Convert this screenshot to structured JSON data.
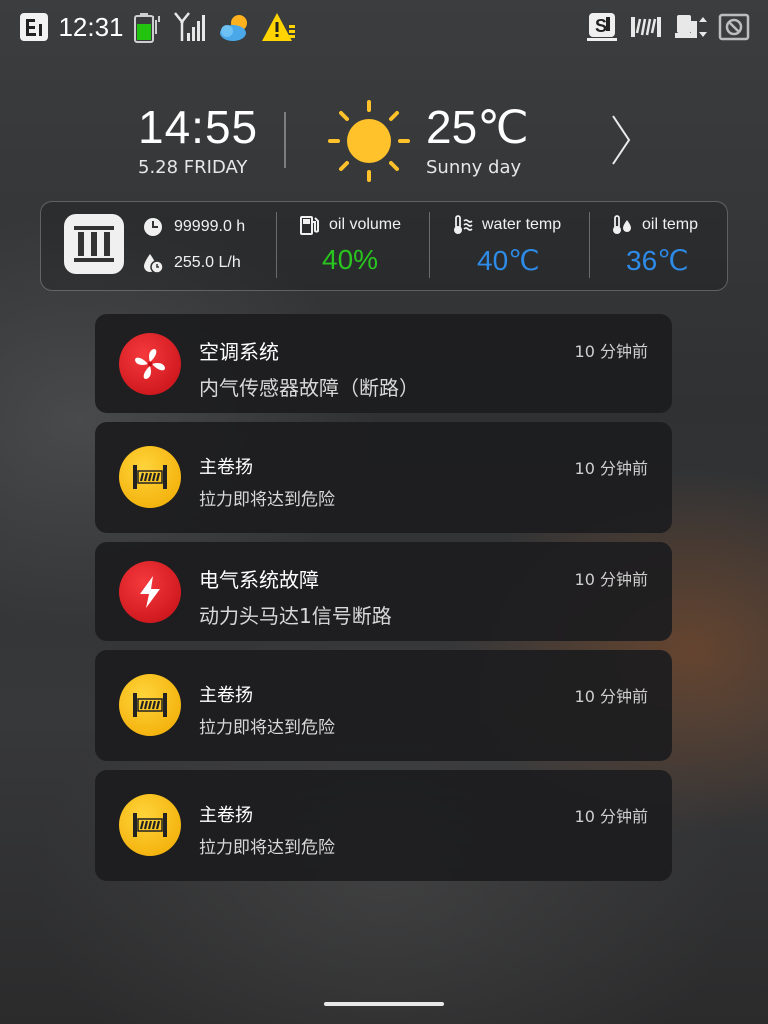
{
  "status_bar": {
    "time": "12:31",
    "left_icons": [
      "e1-badge-icon",
      "battery-charging-icon",
      "signal-icon",
      "weather-cloud-icon",
      "warning-icon"
    ],
    "right_icons": [
      "s-mode-icon",
      "winch-icon",
      "machine-icon",
      "camera-off-icon"
    ],
    "battery_color": "#22c40f",
    "warning_color": "#ffd400"
  },
  "clock": {
    "time": "14:55",
    "date": "5.28 FRIDAY"
  },
  "weather": {
    "temp": "25℃",
    "desc": "Sunny day",
    "icon": "sun-icon",
    "sun_color": "#ffc22a"
  },
  "info_panel": {
    "engine_icon": "engine-icon",
    "hours": "99999.0 h",
    "consumption": "255.0 L/h",
    "stats": [
      {
        "label": "oil volume",
        "value": "40%",
        "icon": "fuel-pump-icon",
        "color": "#29c41f"
      },
      {
        "label": "water temp",
        "value": "40℃",
        "icon": "water-temp-icon",
        "color": "#2e8be8"
      },
      {
        "label": "oil temp",
        "value": "36℃",
        "icon": "oil-temp-icon",
        "color": "#2e8be8"
      }
    ]
  },
  "notifications": [
    {
      "title": "空调系统",
      "message": "内气传感器故障（断路）",
      "time": "10 分钟前",
      "icon": "fan-icon",
      "severity": "red"
    },
    {
      "title": "主卷扬",
      "message": "拉力即将达到危险",
      "time": "10 分钟前",
      "icon": "winch-icon",
      "severity": "yellow"
    },
    {
      "title": "电气系统故障",
      "message": "动力头马达1信号断路",
      "time": "10 分钟前",
      "icon": "lightning-icon",
      "severity": "red"
    },
    {
      "title": "主卷扬",
      "message": "拉力即将达到危险",
      "time": "10 分钟前",
      "icon": "winch-icon",
      "severity": "yellow"
    },
    {
      "title": "主卷扬",
      "message": "拉力即将达到危险",
      "time": "10 分钟前",
      "icon": "winch-icon",
      "severity": "yellow"
    }
  ]
}
